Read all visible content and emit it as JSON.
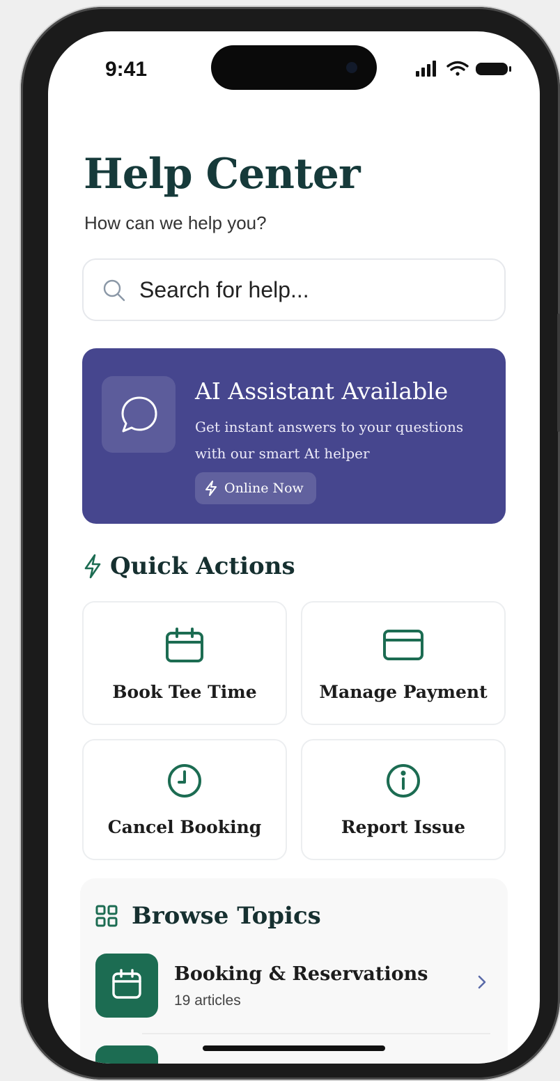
{
  "status_bar": {
    "time": "9:41"
  },
  "header": {
    "title": "Help Center",
    "subtitle": "How can we help you?"
  },
  "search": {
    "placeholder": "Search for help..."
  },
  "ai_card": {
    "title": "AI Assistant Available",
    "description": "Get instant answers to your questions with our smart At helper",
    "badge": "Online Now",
    "color": "#46468e"
  },
  "quick_actions": {
    "title": "Quick Actions",
    "items": [
      {
        "label": "Book Tee Time",
        "icon": "calendar-icon"
      },
      {
        "label": "Manage Payment",
        "icon": "credit-card-icon"
      },
      {
        "label": "Cancel Booking",
        "icon": "clock-icon"
      },
      {
        "label": "Report Issue",
        "icon": "info-icon"
      }
    ]
  },
  "browse_topics": {
    "title": "Browse Topics",
    "items": [
      {
        "title": "Booking & Reservations",
        "count": "19 articles",
        "icon": "calendar-icon"
      }
    ]
  },
  "colors": {
    "accent_green": "#1c6c52",
    "title_color": "#163a3a"
  }
}
